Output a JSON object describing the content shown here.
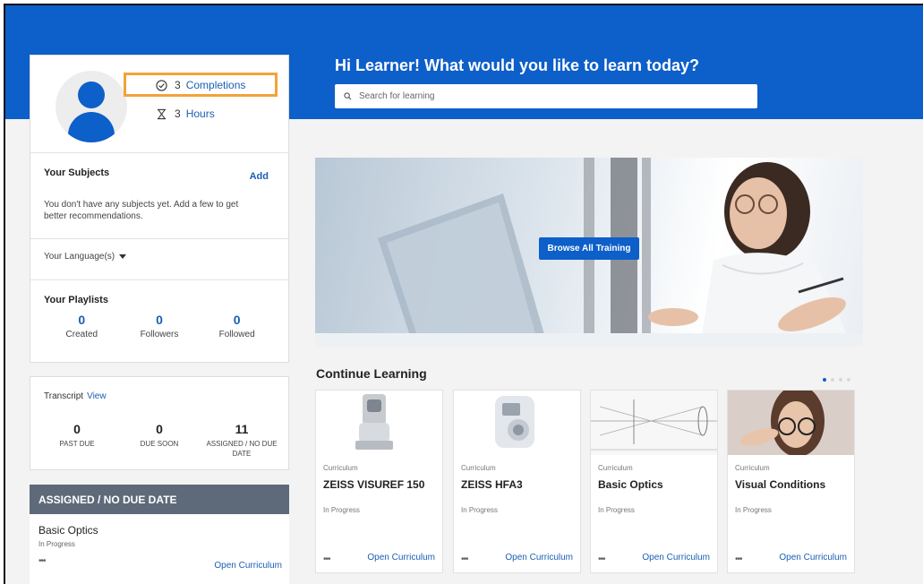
{
  "hero": {
    "greeting": "Hi Learner! What would you like to learn today?",
    "search_placeholder": "Search for learning"
  },
  "profile": {
    "completions_count": "3",
    "completions_label": "Completions",
    "hours_count": "3",
    "hours_label": "Hours"
  },
  "subjects": {
    "title": "Your Subjects",
    "add_label": "Add",
    "message": "You don't have any subjects yet. Add a few to get better recommendations."
  },
  "language": {
    "label": "Your Language(s)"
  },
  "playlists": {
    "title": "Your Playlists",
    "stats": [
      {
        "value": "0",
        "label": "Created"
      },
      {
        "value": "0",
        "label": "Followers"
      },
      {
        "value": "0",
        "label": "Followed"
      }
    ]
  },
  "transcript": {
    "title": "Transcript",
    "view_label": "View",
    "stats": [
      {
        "value": "0",
        "label": "PAST DUE"
      },
      {
        "value": "0",
        "label": "DUE SOON"
      },
      {
        "value": "11",
        "label": "ASSIGNED / NO DUE DATE"
      }
    ]
  },
  "assigned": {
    "header": "ASSIGNED / NO DUE DATE",
    "item_title": "Basic Optics",
    "item_status": "In Progress",
    "more": "•••",
    "open_label": "Open Curriculum"
  },
  "banner": {
    "button_label": "Browse All Training"
  },
  "continue_learning": {
    "title": "Continue Learning",
    "courses": [
      {
        "type": "Curriculum",
        "name": "ZEISS VISUREF 150",
        "status": "In Progress",
        "more": "•••",
        "open_label": "Open Curriculum"
      },
      {
        "type": "Curriculum",
        "name": "ZEISS HFA3",
        "status": "In Progress",
        "more": "•••",
        "open_label": "Open Curriculum"
      },
      {
        "type": "Curriculum",
        "name": "Basic Optics",
        "status": "In Progress",
        "more": "•••",
        "open_label": "Open Curriculum"
      },
      {
        "type": "Curriculum",
        "name": "Visual Conditions",
        "status": "In Progress",
        "more": "•••",
        "open_label": "Open Curriculum"
      }
    ]
  },
  "colors": {
    "brand_blue": "#0d5fc9",
    "link_blue": "#1a5fb4",
    "highlight_orange": "#f2a33a",
    "assigned_header": "#5e6a7a"
  }
}
